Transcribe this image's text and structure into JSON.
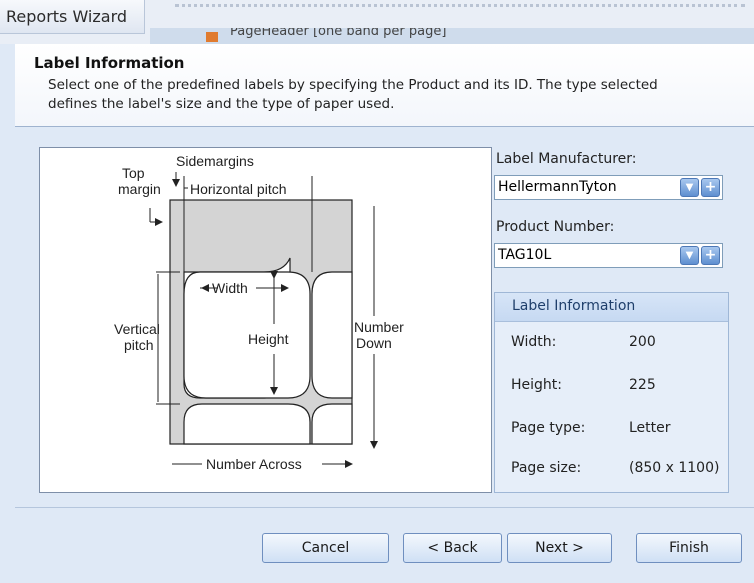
{
  "window": {
    "title_tab": "Reports Wizard",
    "band_label": "PageHeader [one band per page]"
  },
  "header": {
    "title": "Label Information",
    "description": "Select one of the predefined labels by specifying the Product and its ID. The type selected defines the label's size and the type of paper used."
  },
  "diagram": {
    "labels": {
      "side_margins": "Sidemargins",
      "top_margin_line1": "Top",
      "top_margin_line2": "margin",
      "horizontal_pitch": "Horizontal pitch",
      "width": "Width",
      "height": "Height",
      "vertical_pitch_line1": "Vertical",
      "vertical_pitch_line2": "pitch",
      "number_down_line1": "Number",
      "number_down_line2": "Down",
      "number_across": "Number Across"
    }
  },
  "form": {
    "manufacturer_label": "Label Manufacturer:",
    "manufacturer_value": "HellermannTyton",
    "product_label": "Product Number:",
    "product_value": "TAG10L"
  },
  "label_info": {
    "header": "Label Information",
    "rows": [
      {
        "label": "Width:",
        "value": "200"
      },
      {
        "label": "Height:",
        "value": "225"
      },
      {
        "label": "Page type:",
        "value": "Letter"
      },
      {
        "label": "Page size:",
        "value": "(850 x 1100)"
      }
    ]
  },
  "buttons": {
    "cancel": "Cancel",
    "back": "< Back",
    "next": "Next >",
    "finish": "Finish"
  }
}
